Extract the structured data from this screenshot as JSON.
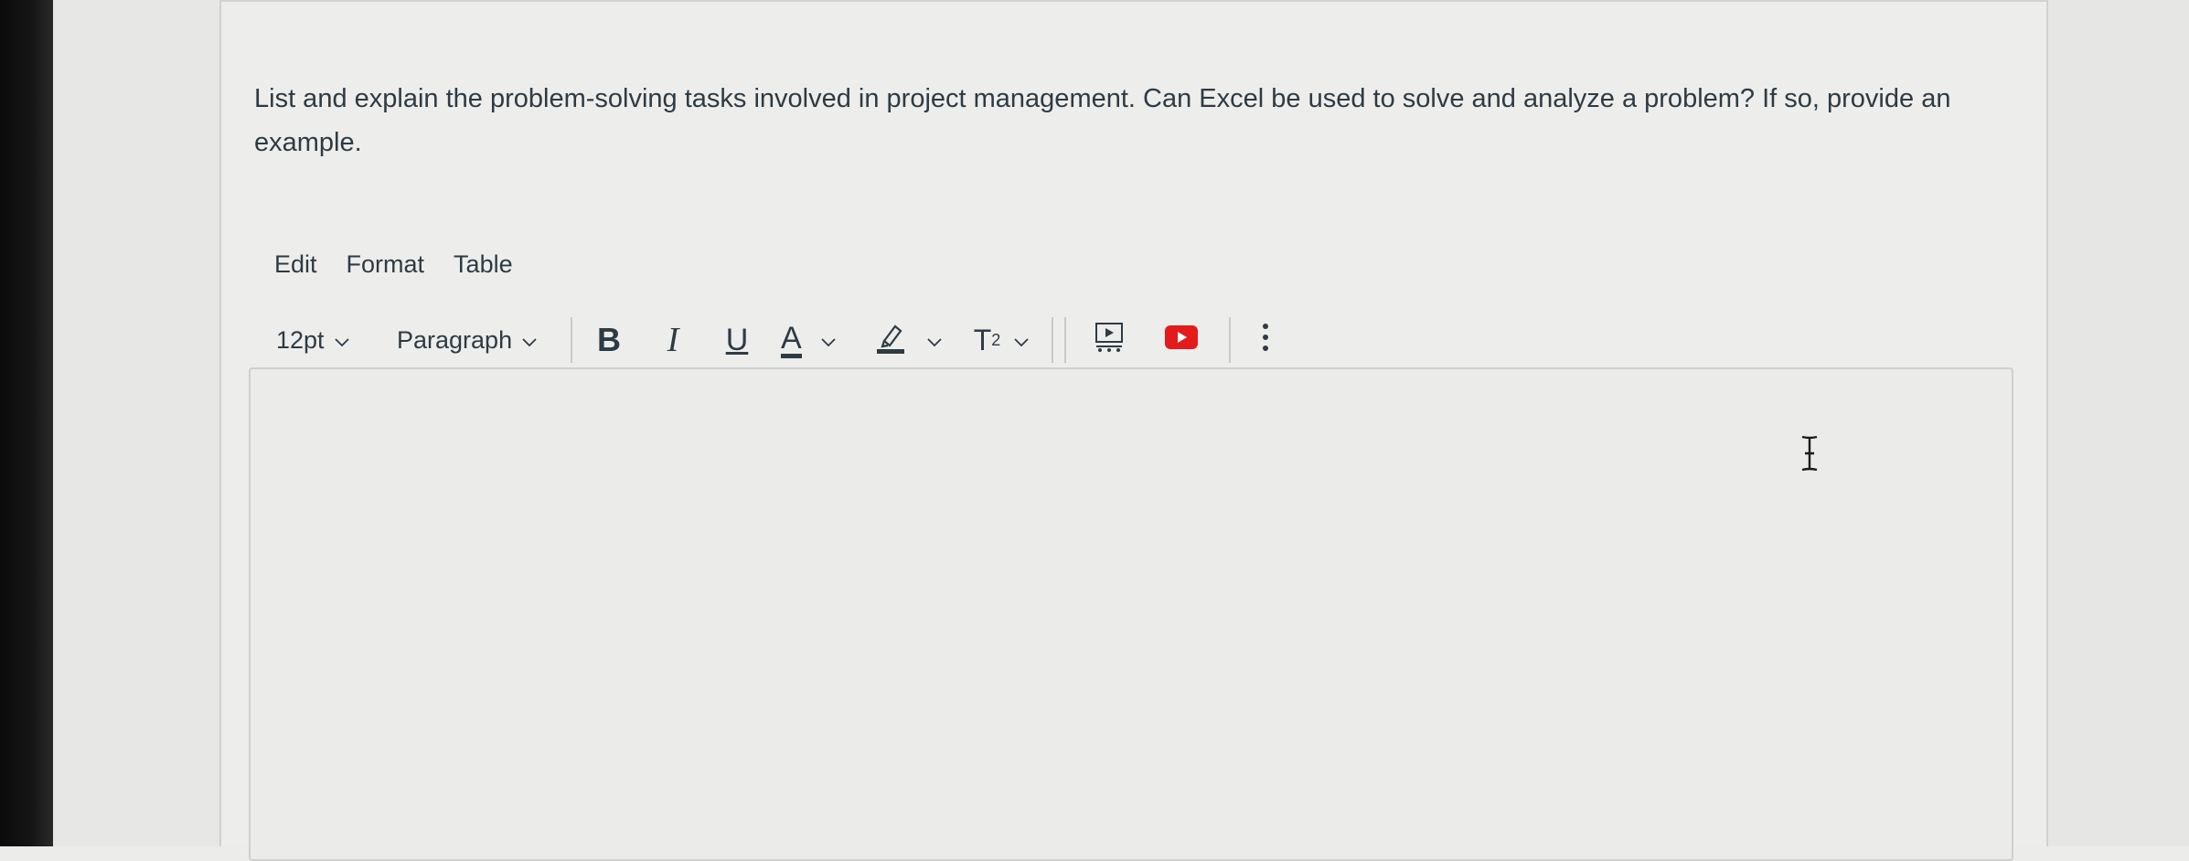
{
  "question": {
    "text": "List and explain the problem-solving tasks involved in project management. Can Excel be used to solve and analyze a problem? If so, provide an example."
  },
  "menubar": {
    "edit": "Edit",
    "format": "Format",
    "table": "Table"
  },
  "toolbar": {
    "font_size": "12pt",
    "block_format": "Paragraph",
    "bold": "B",
    "italic": "I",
    "underline": "U",
    "text_color": "A",
    "superscript_base": "T",
    "superscript_exp": "2",
    "icons": [
      "chevron-down-icon",
      "highlighter-icon",
      "media-icon",
      "youtube-icon",
      "more-vertical-icon"
    ]
  },
  "editor": {
    "value": ""
  },
  "colors": {
    "text": "#2d3b45",
    "youtube_red": "#e31b1b",
    "editor_border": "#cfcfcd"
  }
}
